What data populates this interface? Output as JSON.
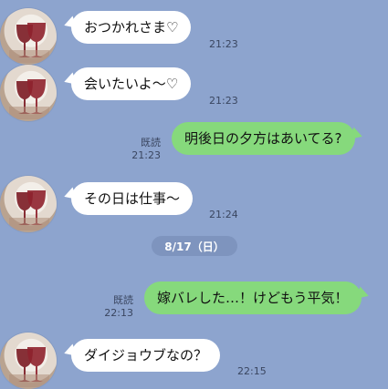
{
  "messages": [
    {
      "side": "in",
      "text": "おつかれさま♡",
      "time": "21:23"
    },
    {
      "side": "in",
      "text": "会いたいよ～♡",
      "time": "21:23"
    },
    {
      "side": "out",
      "text": "明後日の夕方はあいてる?",
      "status": "既読",
      "time": "21:23"
    },
    {
      "side": "in",
      "text": "その日は仕事～",
      "time": "21:24"
    },
    {
      "side": "date",
      "text": "8/17（日）"
    },
    {
      "side": "out",
      "text": "嫁バレした…！けどもう平気！",
      "status": "既読",
      "time": "22:13"
    },
    {
      "side": "in",
      "text": "ダイジョウブなの？",
      "time": "22:15"
    }
  ],
  "colors": {
    "background": "#8DA4CE",
    "incoming_bubble": "#FFFFFF",
    "outgoing_bubble": "#86D97C"
  },
  "icons": {
    "avatar": "wine-glasses-avatar-icon"
  }
}
